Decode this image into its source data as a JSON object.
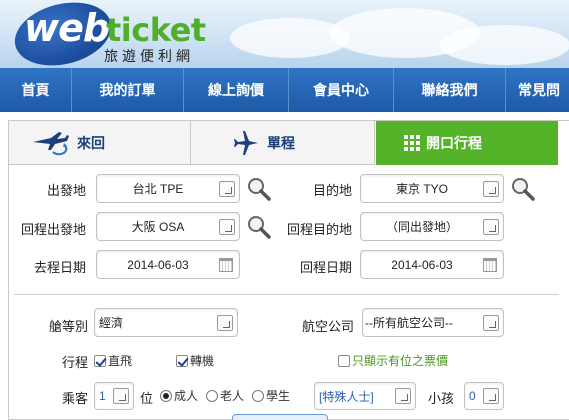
{
  "header": {
    "logo_web": "web",
    "logo_ticket": "ticket",
    "logo_sub": "旅遊便利網"
  },
  "nav": {
    "items": [
      "首頁",
      "我的訂單",
      "線上詢價",
      "會員中心",
      "聯絡我們",
      "常見問"
    ]
  },
  "tabs": {
    "round_trip": "來回",
    "one_way": "單程",
    "open_jaw": "開口行程"
  },
  "form": {
    "origin_label": "出發地",
    "origin_value": "台北 TPE",
    "destination_label": "目的地",
    "destination_value": "東京 TYO",
    "return_origin_label": "回程出發地",
    "return_origin_value": "大阪 OSA",
    "return_dest_label": "回程目的地",
    "return_dest_value": "（同出發地）",
    "depart_date_label": "去程日期",
    "depart_date_value": "2014-06-03",
    "return_date_label": "回程日期",
    "return_date_value": "2014-06-03",
    "cabin_label": "艙等別",
    "cabin_value": "經濟",
    "airline_label": "航空公司",
    "airline_value": "--所有航空公司--",
    "itinerary_label": "行程",
    "direct_label": "直飛",
    "transfer_label": "轉機",
    "seats_only_label": "只顯示有位之票價",
    "passenger_label": "乘客",
    "passenger_count": "1",
    "seat_unit": "位",
    "adult_label": "成人",
    "senior_label": "老人",
    "student_label": "學生",
    "special_value": "[特殊人士]",
    "child_label": "小孩",
    "child_count": "0"
  },
  "colors": {
    "nav_blue": "#1d5aa7",
    "tab_green": "#55b32a",
    "logo_green": "#4fae2a",
    "accent_green_text": "#4a9a1e"
  }
}
